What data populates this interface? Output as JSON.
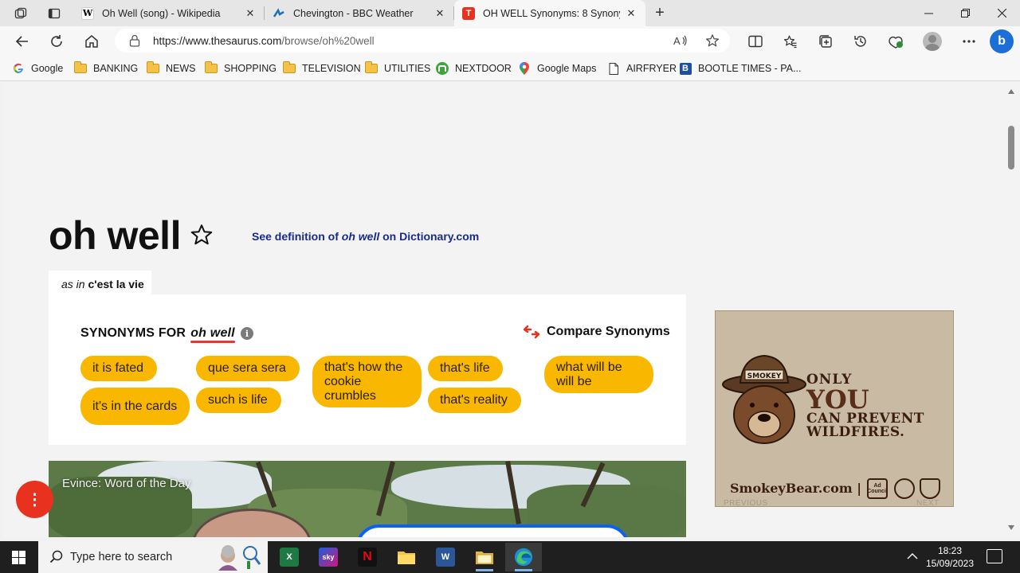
{
  "browser": {
    "tabs": [
      {
        "title": "Oh Well (song) - Wikipedia",
        "favicon": "W",
        "favicon_color": "#ffffff",
        "active": false
      },
      {
        "title": "Chevington - BBC Weather",
        "favicon": "bbc-weather-icon",
        "favicon_color": "#1d70b8",
        "active": false
      },
      {
        "title": "OH WELL Synonyms: 8 Synonyms",
        "favicon": "T",
        "favicon_color": "#e8321f",
        "active": true
      }
    ],
    "address_bar": {
      "url_host": "https://www.thesaurus.com",
      "url_path": "/browse/oh%20well"
    },
    "bookmarks": [
      {
        "label": "Google",
        "icon": "google-icon"
      },
      {
        "label": "BANKING",
        "icon": "folder-icon"
      },
      {
        "label": "NEWS",
        "icon": "folder-icon"
      },
      {
        "label": "SHOPPING",
        "icon": "folder-icon"
      },
      {
        "label": "TELEVISION",
        "icon": "folder-icon"
      },
      {
        "label": "UTILITIES",
        "icon": "folder-icon"
      },
      {
        "label": "NEXTDOOR",
        "icon": "nextdoor-icon"
      },
      {
        "label": "Google Maps",
        "icon": "map-pin-icon"
      },
      {
        "label": "AIRFRYER",
        "icon": "page-icon"
      },
      {
        "label": "BOOTLE TIMES - PA...",
        "icon": "b-icon"
      }
    ]
  },
  "page": {
    "word": "oh well",
    "definition_link": {
      "prefix": "See definition of",
      "word": "oh well",
      "suffix": "on Dictionary.com"
    },
    "sense_tab": {
      "as_in": "as in",
      "sense": "c'est la vie"
    },
    "synonyms_heading": "SYNONYMS FOR",
    "synonyms_word": "oh well",
    "compare_label": "Compare Synonyms",
    "synonyms": [
      "it is fated",
      "it's in the cards",
      "que sera sera",
      "such is life",
      "that's how the cookie crumbles",
      "that's life",
      "that's reality",
      "what will be will be"
    ],
    "chip_color": "#f9b700",
    "video_caption": "Evince: Word of the Day",
    "ad": {
      "hat_text": "SMOKEY",
      "line1": "ONLY",
      "line2": "YOU",
      "line3": "CAN PREVENT",
      "line4": "WILDFIRES.",
      "url": "SmokeyBear.com",
      "partner": "Ad Council",
      "prev": "PREVIOUS",
      "next": "NEXT"
    }
  },
  "taskbar": {
    "search_placeholder": "Type here to search",
    "apps": [
      {
        "name": "Excel",
        "icon": "excel-icon"
      },
      {
        "name": "Sky",
        "icon": "sky-icon"
      },
      {
        "name": "Netflix",
        "icon": "netflix-icon"
      },
      {
        "name": "File Explorer",
        "icon": "folder-icon"
      },
      {
        "name": "Word",
        "icon": "word-icon"
      },
      {
        "name": "Explorer",
        "icon": "explorer-icon"
      },
      {
        "name": "Edge",
        "icon": "edge-icon"
      }
    ],
    "time": "18:23",
    "date": "15/09/2023"
  }
}
